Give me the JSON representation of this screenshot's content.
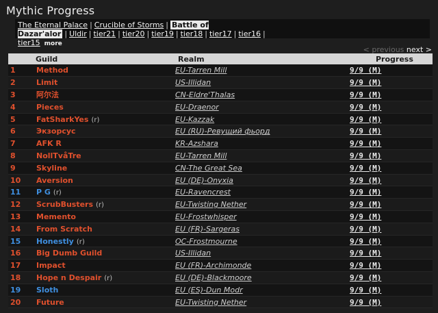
{
  "page": {
    "title": "Mythic Progress"
  },
  "tiers": [
    {
      "label": "The Eternal Palace",
      "active": false
    },
    {
      "label": "Crucible of Storms",
      "active": false
    },
    {
      "label": "Battle of Dazar'alor",
      "active": true
    },
    {
      "label": "Uldir",
      "active": false
    },
    {
      "label": "tier21",
      "active": false
    },
    {
      "label": "tier20",
      "active": false
    },
    {
      "label": "tier19",
      "active": false
    },
    {
      "label": "tier18",
      "active": false
    },
    {
      "label": "tier17",
      "active": false
    },
    {
      "label": "tier16",
      "active": false
    },
    {
      "label": "tier15",
      "active": false
    }
  ],
  "tier_more": "more",
  "pager": {
    "previous": "< previous",
    "next": "next >"
  },
  "table": {
    "headers": {
      "guild": "Guild",
      "realm": "Realm",
      "progress": "Progress"
    },
    "rows": [
      {
        "rank": "1",
        "guild": "Method",
        "realm": "EU-Tarren Mill",
        "progress": "9/9 (M)",
        "color": "#e0502d",
        "rec": ""
      },
      {
        "rank": "2",
        "guild": "Limit",
        "realm": "US-Illidan",
        "progress": "9/9 (M)",
        "color": "#e0502d",
        "rec": ""
      },
      {
        "rank": "3",
        "guild": "阿尔法",
        "realm": "CN-Eldre'Thalas",
        "progress": "9/9 (M)",
        "color": "#e0502d",
        "rec": ""
      },
      {
        "rank": "4",
        "guild": "Pieces",
        "realm": "EU-Draenor",
        "progress": "9/9 (M)",
        "color": "#e0502d",
        "rec": ""
      },
      {
        "rank": "5",
        "guild": "FatSharkYes",
        "realm": "EU-Kazzak",
        "progress": "9/9 (M)",
        "color": "#e0502d",
        "rec": "(r)"
      },
      {
        "rank": "6",
        "guild": "Экзорсус",
        "realm": "EU (RU)-Ревущий фьорд",
        "progress": "9/9 (M)",
        "color": "#e0502d",
        "rec": ""
      },
      {
        "rank": "7",
        "guild": "AFK R",
        "realm": "KR-Azshara",
        "progress": "9/9 (M)",
        "color": "#e0502d",
        "rec": ""
      },
      {
        "rank": "8",
        "guild": "NollTvåTre",
        "realm": "EU-Tarren Mill",
        "progress": "9/9 (M)",
        "color": "#e0502d",
        "rec": ""
      },
      {
        "rank": "9",
        "guild": "Skyline",
        "realm": "CN-The Great Sea",
        "progress": "9/9 (M)",
        "color": "#e0502d",
        "rec": ""
      },
      {
        "rank": "10",
        "guild": "Aversion",
        "realm": "EU (DE)-Onyxia",
        "progress": "9/9 (M)",
        "color": "#e0502d",
        "rec": ""
      },
      {
        "rank": "11",
        "guild": "P G",
        "realm": "EU-Ravencrest",
        "progress": "9/9 (M)",
        "color": "#3f8fe0",
        "rec": "(r)"
      },
      {
        "rank": "12",
        "guild": "ScrubBusters",
        "realm": "EU-Twisting Nether",
        "progress": "9/9 (M)",
        "color": "#e0502d",
        "rec": "(r)"
      },
      {
        "rank": "13",
        "guild": "Memento",
        "realm": "EU-Frostwhisper",
        "progress": "9/9 (M)",
        "color": "#e0502d",
        "rec": ""
      },
      {
        "rank": "14",
        "guild": "From Scratch",
        "realm": "EU (FR)-Sargeras",
        "progress": "9/9 (M)",
        "color": "#e0502d",
        "rec": ""
      },
      {
        "rank": "15",
        "guild": "Honestly",
        "realm": "OC-Frostmourne",
        "progress": "9/9 (M)",
        "color": "#3f8fe0",
        "rec": "(r)"
      },
      {
        "rank": "16",
        "guild": "Big Dumb Guild",
        "realm": "US-Illidan",
        "progress": "9/9 (M)",
        "color": "#e0502d",
        "rec": ""
      },
      {
        "rank": "17",
        "guild": "Impact",
        "realm": "EU (FR)-Archimonde",
        "progress": "9/9 (M)",
        "color": "#e0502d",
        "rec": ""
      },
      {
        "rank": "18",
        "guild": "Hope n Despair",
        "realm": "EU (DE)-Blackmoore",
        "progress": "9/9 (M)",
        "color": "#e0502d",
        "rec": "(r)"
      },
      {
        "rank": "19",
        "guild": "Sloth",
        "realm": "EU (ES)-Dun Modr",
        "progress": "9/9 (M)",
        "color": "#3f8fe0",
        "rec": ""
      },
      {
        "rank": "20",
        "guild": "Future",
        "realm": "EU-Twisting Nether",
        "progress": "9/9 (M)",
        "color": "#e0502d",
        "rec": ""
      }
    ]
  }
}
